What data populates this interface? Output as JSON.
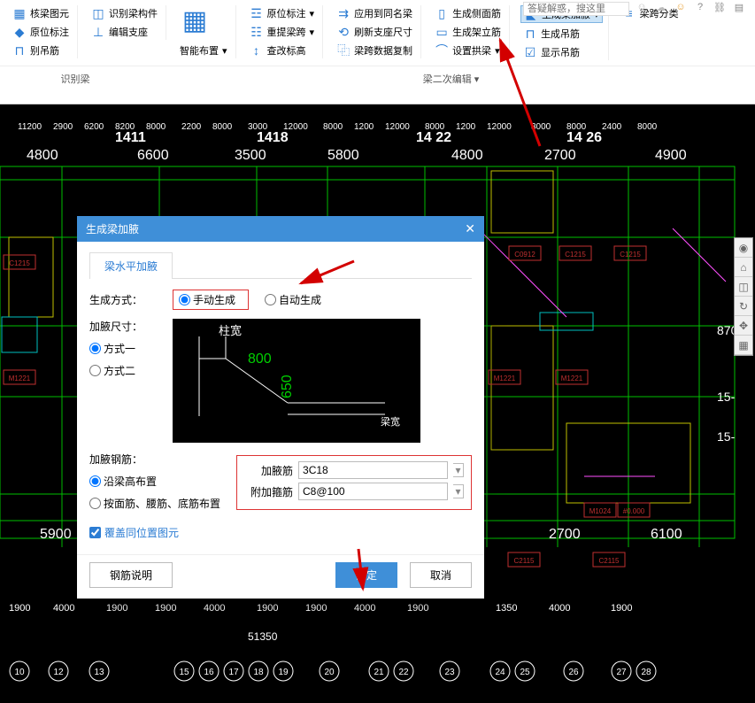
{
  "ribbon": {
    "group1": {
      "a": "核梁图元",
      "b": "识别梁构件",
      "c": "原位标注",
      "d": "编辑支座",
      "e": "别吊筋"
    },
    "group2": {
      "smart": "智能布置"
    },
    "group3": {
      "a": "原位标注",
      "b": "重提梁跨",
      "c": "查改标高",
      "d": "应用到同名梁",
      "e": "刷新支座尺寸",
      "f": "梁跨数据复制"
    },
    "group4": {
      "a": "生成侧面筋",
      "b": "生成架立筋",
      "c": "设置拱梁",
      "d": "生成梁加腋",
      "e": "生成吊筋",
      "f": "显示吊筋",
      "g": "梁跨分类"
    },
    "section_left": "识别梁",
    "section_mid": "梁二次编辑"
  },
  "search": {
    "placeholder": "答疑解惑，搜这里"
  },
  "dialog": {
    "title": "生成梁加腋",
    "tab": "梁水平加腋",
    "gen_mode_label": "生成方式：",
    "manual": "手动生成",
    "auto": "自动生成",
    "size_label": "加腋尺寸：",
    "mode1": "方式一",
    "mode2": "方式二",
    "rebar_label": "加腋钢筋：",
    "along_height": "沿梁高布置",
    "by_top_waist_bottom": "按面筋、腰筋、底筋布置",
    "field1_label": "加腋筋",
    "field1_value": "3C18",
    "field2_label": "附加箍筋",
    "field2_value": "C8@100",
    "checkbox": "覆盖同位置图元",
    "btn_explain": "钢筋说明",
    "btn_ok": "确定",
    "btn_cancel": "取消",
    "diagram": {
      "col_w": "柱宽",
      "d1": "800",
      "d2": "650"
    }
  },
  "dims_top": [
    "1411",
    "1418",
    "14 22",
    "14 26"
  ],
  "dims_spacing": [
    "11200",
    "2900",
    "6200",
    "8200",
    "8000",
    "2200",
    "8000",
    "3000",
    "12000",
    "8000",
    "1200",
    "12000",
    "8000",
    "1200",
    "12000",
    "3000",
    "8000",
    "2400",
    "8000"
  ],
  "dims_mid": [
    "4800",
    "6600",
    "3500",
    "5800",
    "4800",
    "2700",
    "4900"
  ],
  "dims_bottom_in": [
    "5900",
    "2700",
    "6100"
  ],
  "dims_bottom": [
    "1900",
    "4000",
    "1900",
    "1900",
    "4000",
    "1900",
    "1900",
    "4000",
    "1900",
    "1350",
    "4000",
    "1900"
  ],
  "dims_total": "51350",
  "axis_bubbles": [
    "10",
    "12",
    "13",
    "15",
    "16",
    "17",
    "18",
    "19",
    "20",
    "21",
    "22",
    "23",
    "24",
    "25",
    "26",
    "27",
    "28"
  ],
  "right_dims": [
    "870",
    "15-",
    "15-"
  ]
}
